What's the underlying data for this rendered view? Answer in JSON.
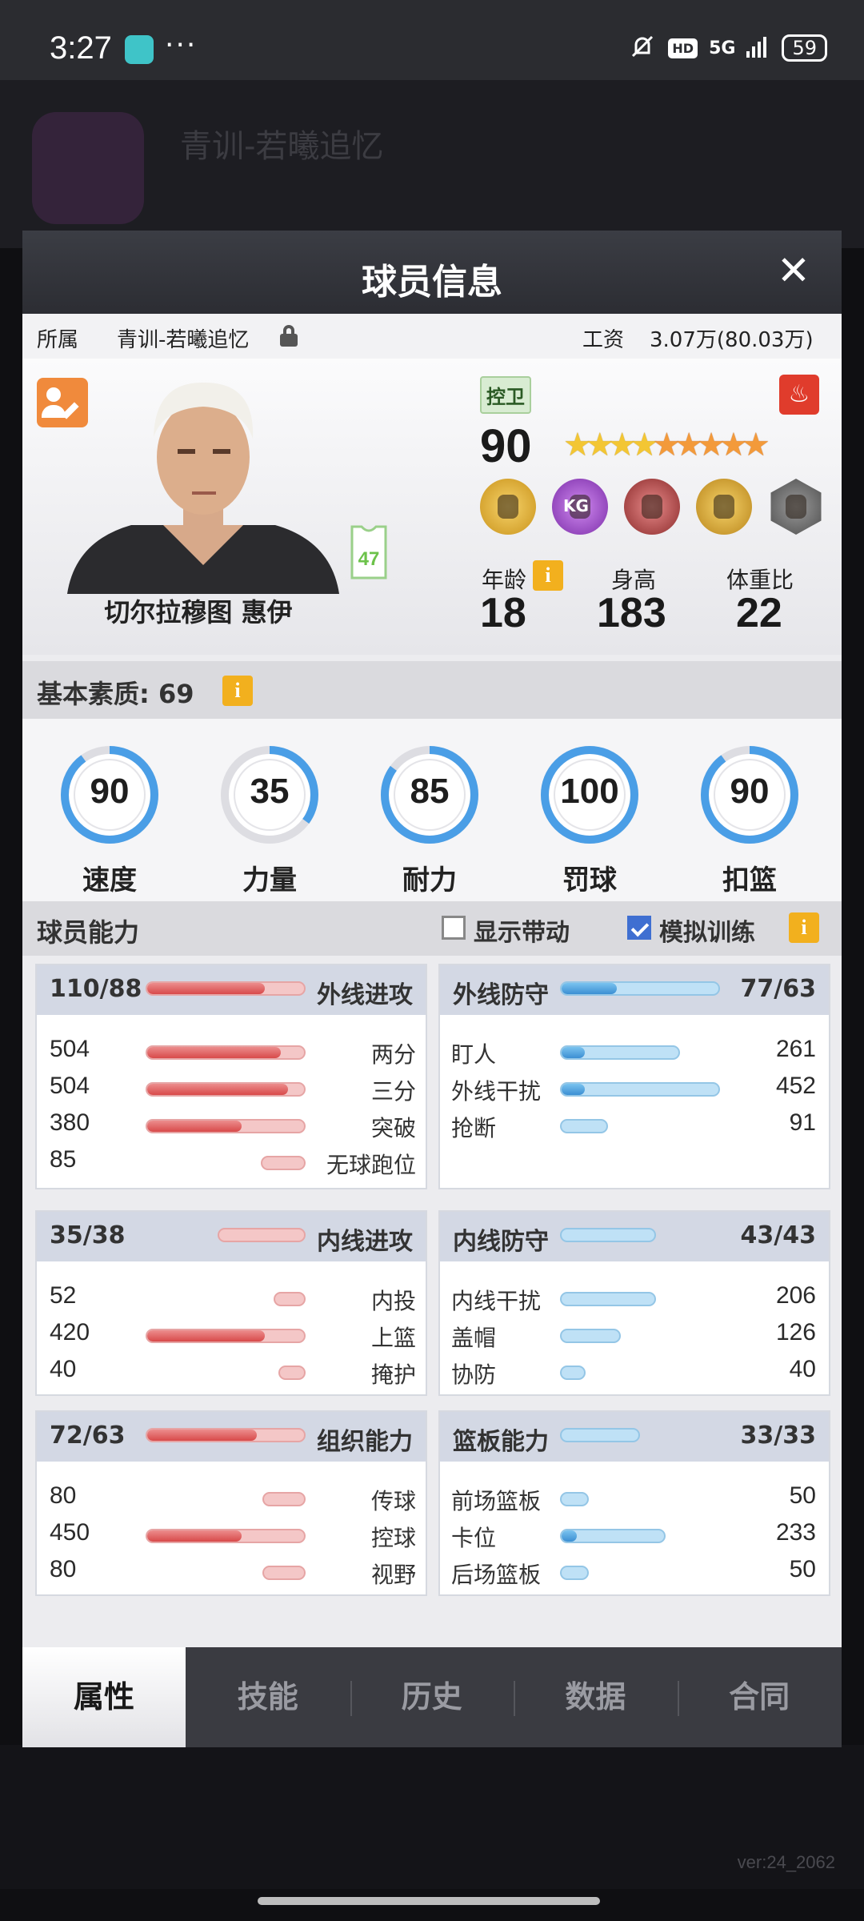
{
  "status_bar": {
    "time": "3:27",
    "dots": "···",
    "hd": "HD",
    "signal": "5G",
    "battery": "59"
  },
  "background": {
    "club_title": "青训-若曦追忆"
  },
  "modal": {
    "title": "球员信息",
    "close": "✕",
    "affiliation_label": "所属",
    "affiliation_value": "青训-若曦追忆",
    "salary_label": "工资",
    "salary_value": "3.07万(80.03万)"
  },
  "player": {
    "name": "切尔拉穆图 惠伊",
    "jersey_number": "47",
    "position": "控卫",
    "rating": "90",
    "stars": {
      "gold": 4,
      "orange": 5
    },
    "age_label": "年龄",
    "age": "18",
    "height_label": "身高",
    "height": "183",
    "weight_ratio_label": "体重比",
    "weight_ratio": "22",
    "badge_kg": "KG"
  },
  "basic": {
    "title": "基本素质: 69",
    "info": "i",
    "gauges": [
      {
        "label": "速度",
        "value": 90
      },
      {
        "label": "力量",
        "value": 35
      },
      {
        "label": "耐力",
        "value": 85
      },
      {
        "label": "罚球",
        "value": 100
      },
      {
        "label": "扣篮",
        "value": 90
      }
    ]
  },
  "ability": {
    "title": "球员能力",
    "show_drive_label": "显示带动",
    "show_drive_checked": false,
    "sim_training_label": "模拟训练",
    "sim_training_checked": true,
    "info": "i",
    "panels": [
      {
        "title": "外线进攻",
        "score": "110/88",
        "bar": 1.0,
        "bar_dark": 0.75,
        "color": "red",
        "rows": [
          {
            "label": "两分",
            "value": "504",
            "bar": 1.0,
            "dark": 0.85
          },
          {
            "label": "三分",
            "value": "504",
            "bar": 1.0,
            "dark": 0.9
          },
          {
            "label": "突破",
            "value": "380",
            "bar": 1.0,
            "dark": 0.6
          },
          {
            "label": "无球跑位",
            "value": "85",
            "bar": 0.28,
            "dark": 0.0
          }
        ]
      },
      {
        "title": "外线防守",
        "score": "77/63",
        "bar": 1.0,
        "bar_dark": 0.35,
        "color": "blue",
        "rows": [
          {
            "label": "盯人",
            "value": "261",
            "bar": 0.75,
            "dark": 0.2
          },
          {
            "label": "外线干扰",
            "value": "452",
            "bar": 1.0,
            "dark": 0.15
          },
          {
            "label": "抢断",
            "value": "91",
            "bar": 0.3,
            "dark": 0.0
          }
        ]
      },
      {
        "title": "内线进攻",
        "score": "35/38",
        "bar": 0.55,
        "bar_dark": 0.0,
        "color": "red",
        "rows": [
          {
            "label": "内投",
            "value": "52",
            "bar": 0.2,
            "dark": 0.0
          },
          {
            "label": "上篮",
            "value": "420",
            "bar": 1.0,
            "dark": 0.75
          },
          {
            "label": "掩护",
            "value": "40",
            "bar": 0.17,
            "dark": 0.0
          }
        ]
      },
      {
        "title": "内线防守",
        "score": "43/43",
        "bar": 0.6,
        "bar_dark": 0.0,
        "color": "blue",
        "rows": [
          {
            "label": "内线干扰",
            "value": "206",
            "bar": 0.6,
            "dark": 0.0
          },
          {
            "label": "盖帽",
            "value": "126",
            "bar": 0.38,
            "dark": 0.0
          },
          {
            "label": "协防",
            "value": "40",
            "bar": 0.16,
            "dark": 0.0
          }
        ]
      },
      {
        "title": "组织能力",
        "score": "72/63",
        "bar": 1.0,
        "bar_dark": 0.7,
        "color": "red",
        "rows": [
          {
            "label": "传球",
            "value": "80",
            "bar": 0.27,
            "dark": 0.0
          },
          {
            "label": "控球",
            "value": "450",
            "bar": 1.0,
            "dark": 0.6
          },
          {
            "label": "视野",
            "value": "80",
            "bar": 0.27,
            "dark": 0.0
          }
        ]
      },
      {
        "title": "篮板能力",
        "score": "33/33",
        "bar": 0.5,
        "bar_dark": 0.0,
        "color": "blue",
        "rows": [
          {
            "label": "前场篮板",
            "value": "50",
            "bar": 0.18,
            "dark": 0.0
          },
          {
            "label": "卡位",
            "value": "233",
            "bar": 0.66,
            "dark": 0.15
          },
          {
            "label": "后场篮板",
            "value": "50",
            "bar": 0.18,
            "dark": 0.0
          }
        ]
      }
    ]
  },
  "tabs": [
    "属性",
    "技能",
    "历史",
    "数据",
    "合同"
  ],
  "active_tab": 0,
  "version": "ver:24_2062",
  "colors": {
    "accent_red": "#d84a4a",
    "accent_blue": "#3c8fd3",
    "gauge_blue": "#4a9ee6",
    "info_yellow": "#f2b01e"
  }
}
